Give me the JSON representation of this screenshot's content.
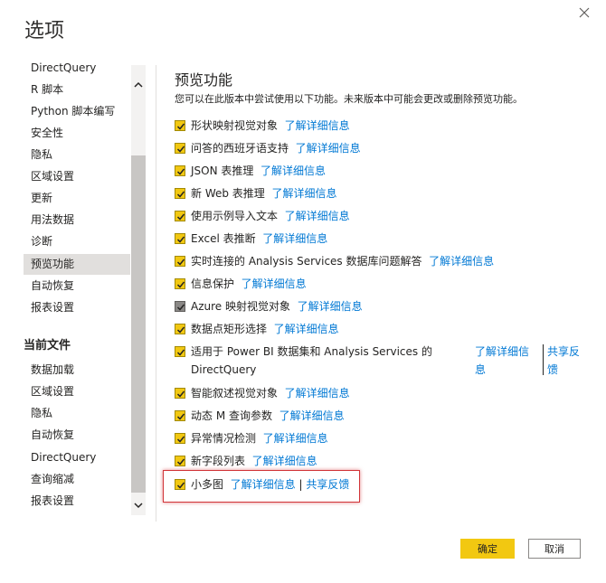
{
  "dialog": {
    "title": "选项",
    "ok_label": "确定",
    "cancel_label": "取消"
  },
  "nav": {
    "global_items": [
      "DirectQuery",
      "R 脚本",
      "Python 脚本编写",
      "安全性",
      "隐私",
      "区域设置",
      "更新",
      "用法数据",
      "诊断",
      "预览功能",
      "自动恢复",
      "报表设置"
    ],
    "current_file_header": "当前文件",
    "current_file_items": [
      "数据加载",
      "区域设置",
      "隐私",
      "自动恢复",
      "DirectQuery",
      "查询缩减",
      "报表设置"
    ],
    "selected": "预览功能"
  },
  "content": {
    "title": "预览功能",
    "description": "您可以在此版本中尝试使用以下功能。未来版本中可能会更改或删除预览功能。",
    "learn_more": "了解详细信息",
    "feedback": "共享反馈",
    "features": [
      {
        "label": "形状映射视觉对象",
        "checked": true
      },
      {
        "label": "问答的西班牙语支持",
        "checked": true
      },
      {
        "label": "JSON 表推理",
        "checked": true
      },
      {
        "label": "新 Web 表推理",
        "checked": true
      },
      {
        "label": "使用示例导入文本",
        "checked": true
      },
      {
        "label": "Excel 表推断",
        "checked": true
      },
      {
        "label": "实时连接的 Analysis Services 数据库问题解答",
        "checked": true
      },
      {
        "label": "信息保护",
        "checked": true
      },
      {
        "label": "Azure 映射视觉对象",
        "checked": true
      },
      {
        "label": "数据点矩形选择",
        "checked": true
      }
    ],
    "multiline_feature": {
      "label_line1": "适用于 Power BI 数据集和 Analysis Services 的",
      "label_line2": "DirectQuery",
      "link_line1": "了解详细信",
      "link_line2": "息",
      "feedback_line1": "共享反",
      "feedback_line2": "馈"
    },
    "features_after": [
      {
        "label": "智能叙述视觉对象",
        "checked": true
      },
      {
        "label": "动态 M 查询参数",
        "checked": true
      },
      {
        "label": "异常情况检测",
        "checked": true
      },
      {
        "label": "新字段列表",
        "checked": true
      }
    ],
    "last_feature": {
      "label": "小多图",
      "checked": true
    }
  }
}
